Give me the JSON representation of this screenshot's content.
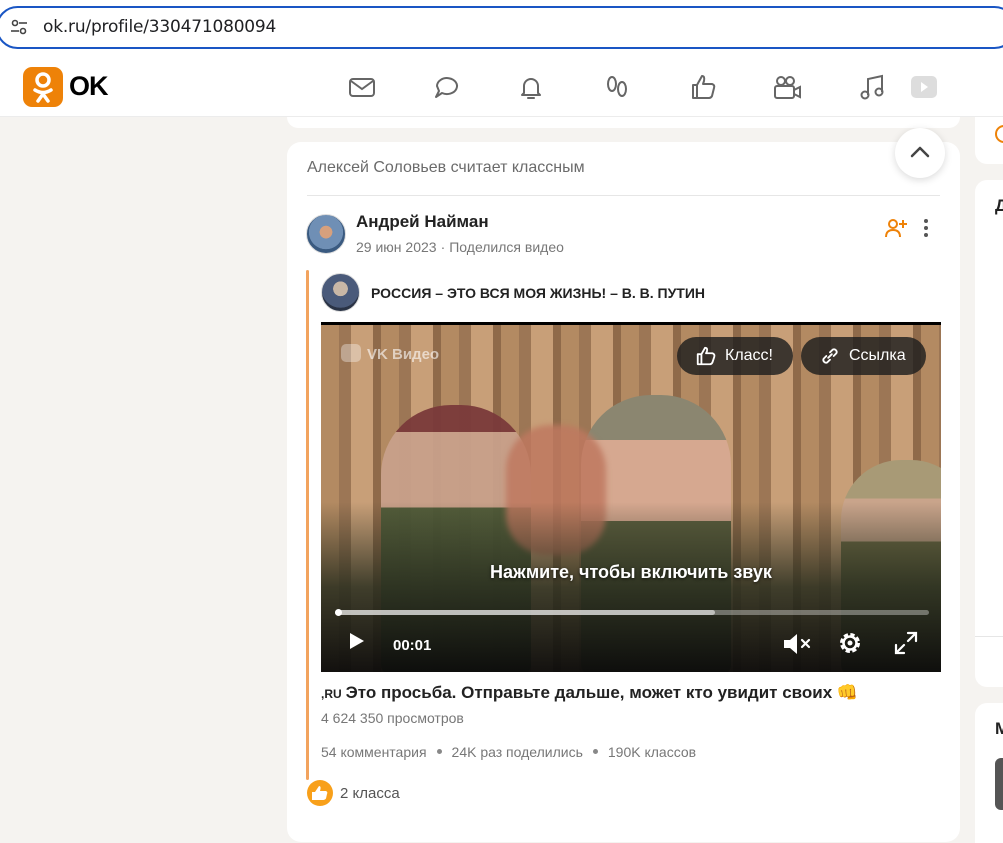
{
  "browser": {
    "url": "ok.ru/profile/330471080094"
  },
  "header": {
    "logo_text": "OK",
    "nav_icons": [
      "mail-icon",
      "chat-icon",
      "bell-icon",
      "footprints-icon",
      "thumb-up-icon",
      "camera-icon",
      "music-icon",
      "video-icon"
    ]
  },
  "post": {
    "liked_by": "Алексей Соловьев считает классным",
    "author": "Андрей Найман",
    "date": "29 июн 2023",
    "action": "Поделился видео",
    "group_title": "РОССИЯ – ЭТО ВСЯ МОЯ ЖИЗНЬ! – В. В. ПУТИН",
    "video": {
      "source_label": "VK Видео",
      "klass_label": "Класс!",
      "link_label": "Ссылка",
      "tap_sound": "Нажмите, чтобы включить звук",
      "time": "00:01",
      "buffered_fraction": 0.64
    },
    "caption_tag": ",RU",
    "caption": "Это просьба. Отправьте дальше, может кто увидит своих 👊",
    "views": "4 624 350 просмотров",
    "comments": "54 комментария",
    "shares": "24K раз поделились",
    "klasses": "190K классов",
    "likes": "2 класса"
  },
  "right": {
    "card2_letter": "Д",
    "card3_letter": "М"
  },
  "colors": {
    "accent": "#ee8208",
    "url_border": "#1a56c4",
    "share_line": "#f2a35e"
  }
}
